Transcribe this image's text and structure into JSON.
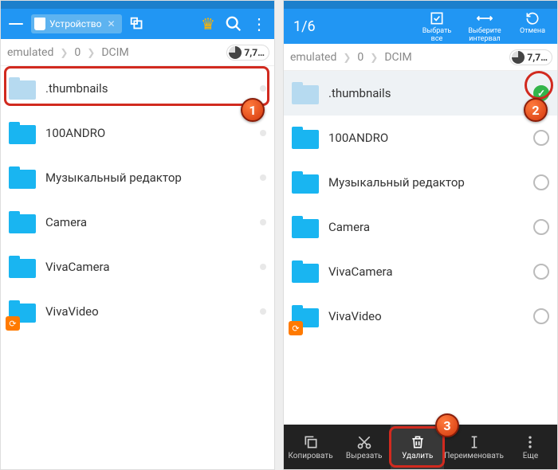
{
  "left": {
    "tab_label": "Устройство",
    "breadcrumb": [
      "emulated",
      "0",
      "DCIM"
    ],
    "storage": "7,7…",
    "folders": [
      {
        "name": ".thumbnails",
        "style": "light",
        "has_vv": false
      },
      {
        "name": "100ANDRO",
        "style": "solid",
        "has_vv": false
      },
      {
        "name": "Музыкальный редактор",
        "style": "solid",
        "has_vv": false
      },
      {
        "name": "Camera",
        "style": "solid",
        "has_vv": false
      },
      {
        "name": "VivaCamera",
        "style": "solid",
        "has_vv": false
      },
      {
        "name": "VivaVideo",
        "style": "solid",
        "has_vv": true
      }
    ]
  },
  "right": {
    "selection_count": "1/6",
    "actions": {
      "select_all": "Выбрать все",
      "select_range": "Выберите интервал",
      "cancel": "Отмена"
    },
    "breadcrumb": [
      "emulated",
      "0",
      "DCIM"
    ],
    "storage": "7,7…",
    "folders": [
      {
        "name": ".thumbnails",
        "style": "light",
        "selected": true,
        "has_vv": false
      },
      {
        "name": "100ANDRO",
        "style": "solid",
        "selected": false,
        "has_vv": false
      },
      {
        "name": "Музыкальный редактор",
        "style": "solid",
        "selected": false,
        "has_vv": false
      },
      {
        "name": "Camera",
        "style": "solid",
        "selected": false,
        "has_vv": false
      },
      {
        "name": "VivaCamera",
        "style": "solid",
        "selected": false,
        "has_vv": false
      },
      {
        "name": "VivaVideo",
        "style": "solid",
        "selected": false,
        "has_vv": true
      }
    ],
    "bottom": {
      "copy": "Копировать",
      "cut": "Вырезать",
      "delete": "Удалить",
      "rename": "Переименовать",
      "more": "Еще"
    }
  },
  "callouts": {
    "c1": "1",
    "c2": "2",
    "c3": "3"
  }
}
